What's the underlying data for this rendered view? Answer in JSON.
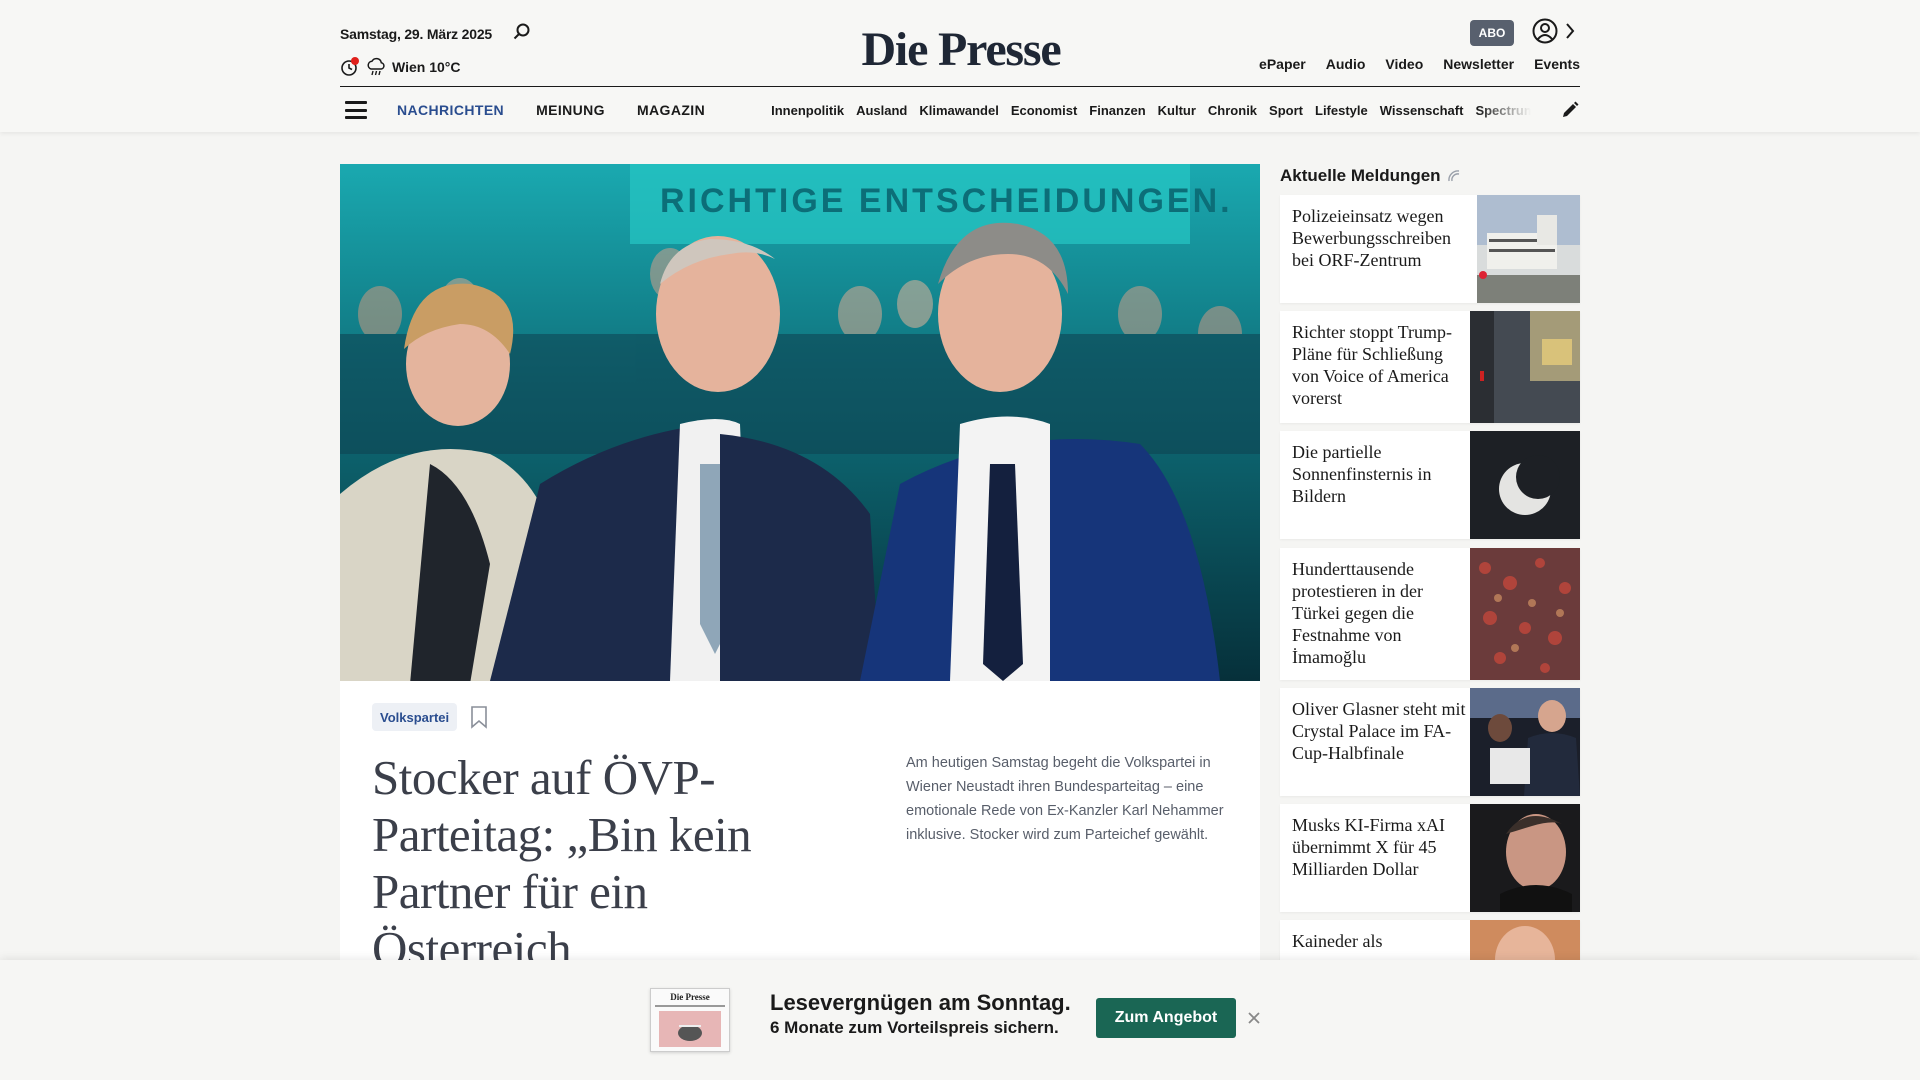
{
  "header": {
    "date": "Samstag, 29. März 2025",
    "weather": "Wien 10°C",
    "logo": "Die Presse",
    "abo_label": "ABO",
    "utility_links": [
      "ePaper",
      "Audio",
      "Video",
      "Newsletter",
      "Events"
    ]
  },
  "nav": {
    "main": [
      "NACHRICHTEN",
      "MEINUNG",
      "MAGAZIN"
    ],
    "sub": [
      "Innenpolitik",
      "Ausland",
      "Klimawandel",
      "Economist",
      "Finanzen",
      "Kultur",
      "Chronik",
      "Sport",
      "Lifestyle",
      "Wissenschaft",
      "Spectrum"
    ]
  },
  "hero": {
    "banner_text": "RICHTIGE ENTSCHEIDUNGEN."
  },
  "article": {
    "tag": "Volkspartei",
    "headline": "Stocker auf ÖVP-Parteitag: „Bin kein Partner für ein Österreich",
    "teaser": "Am heutigen Samstag begeht die Volkspartei in Wiener Neustadt ihren Bundesparteitag – eine emotionale Rede von Ex-Kanzler Karl Nehammer inklusive. Stocker wird zum Parteichef gewählt."
  },
  "sidebar": {
    "title": "Aktuelle Meldungen",
    "items": [
      {
        "title": "Polizeieinsatz wegen Bewerbungsschreiben bei ORF-Zentrum"
      },
      {
        "title": "Richter stoppt Trump-Pläne für Schließung von Voice of America vorerst"
      },
      {
        "title": "Die partielle Sonnenfinsternis in Bildern"
      },
      {
        "title": "Hunderttausende protestieren in der Türkei gegen die Festnahme von İmamoğlu"
      },
      {
        "title": "Oliver Glasner steht mit Crystal Palace im FA-Cup-Halbfinale"
      },
      {
        "title": "Musks KI-Firma xAI übernimmt X für 45 Milliarden Dollar"
      },
      {
        "title": "Kaineder als"
      }
    ]
  },
  "banner": {
    "thumb_logo": "Die Presse",
    "title": "Lesevergnügen am Sonntag.",
    "subtitle": "6 Monate zum Vorteilspreis sichern.",
    "button": "Zum Angebot"
  }
}
